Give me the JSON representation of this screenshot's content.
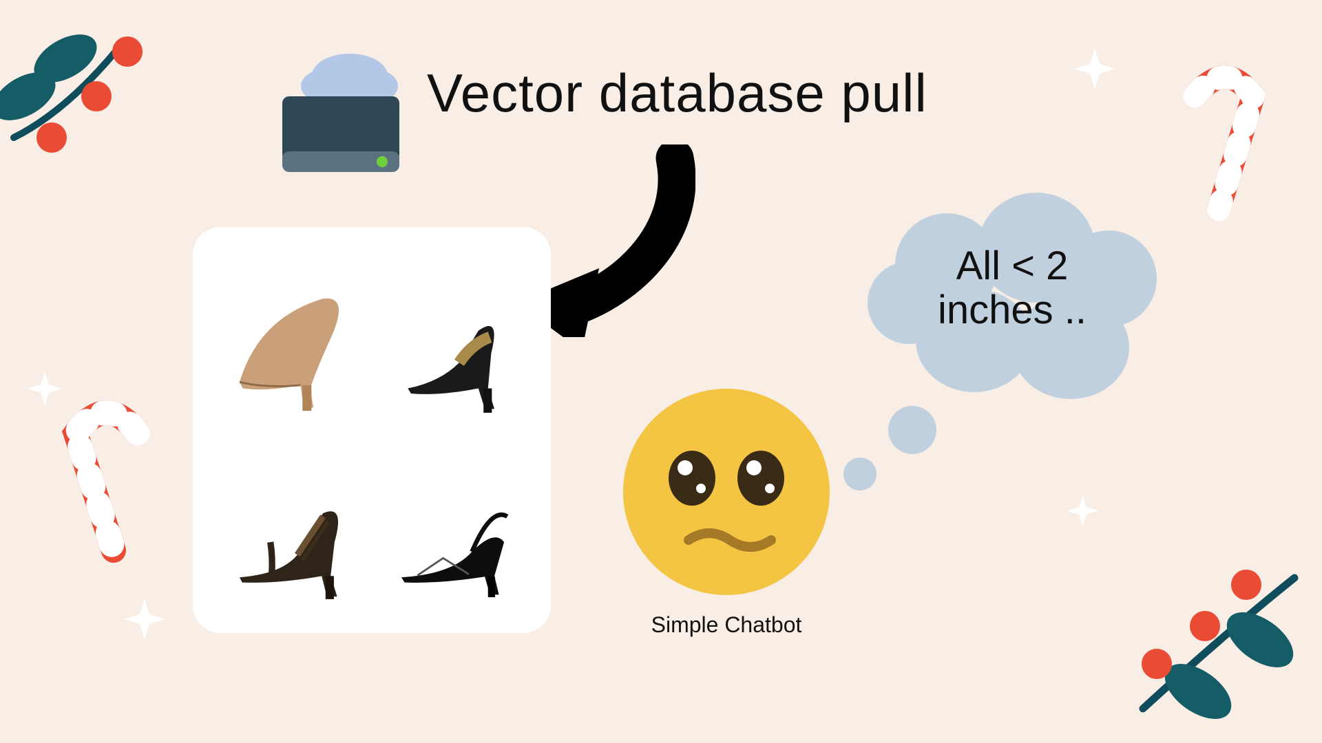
{
  "title": "Vector database pull",
  "thought": {
    "line1": "All < 2",
    "line2": "inches .."
  },
  "chatbot_label": "Simple Chatbot",
  "products": [
    {
      "slot": "top-left"
    },
    {
      "slot": "top-right"
    },
    {
      "slot": "bottom-left"
    },
    {
      "slot": "bottom-right"
    }
  ]
}
